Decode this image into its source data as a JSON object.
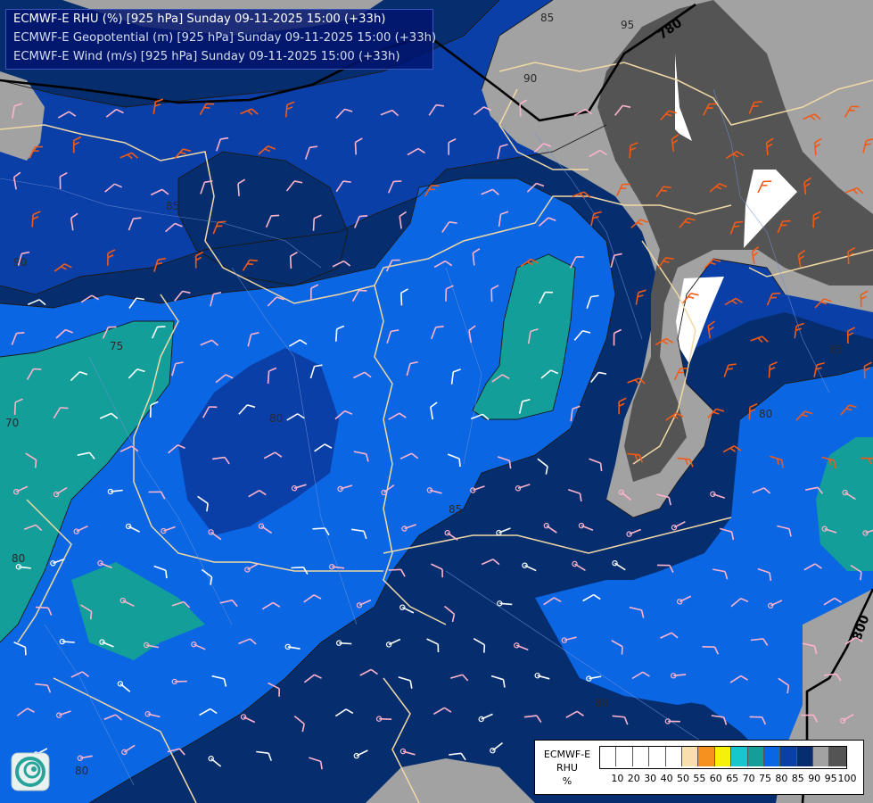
{
  "titles": {
    "line1": "ECMWF-E RHU (%) [925 hPa] Sunday 09-11-2025 15:00 (+33h)",
    "line2": "ECMWF-E Geopotential (m) [925 hPa] Sunday 09-11-2025 15:00 (+33h)",
    "line3": "ECMWF-E Wind (m/s) [925 hPa] Sunday 09-11-2025 15:00 (+33h)"
  },
  "legend": {
    "label_line1": "ECMWF-E",
    "label_line2": "RHU",
    "label_line3": "%",
    "ticks": [
      "10",
      "20",
      "30",
      "40",
      "50",
      "55",
      "60",
      "65",
      "70",
      "75",
      "80",
      "85",
      "90",
      "95",
      "100"
    ],
    "colors": [
      "#ffffff",
      "#ffffff",
      "#ffffff",
      "#ffffff",
      "#ffffff",
      "#f9deae",
      "#f6901e",
      "#f5f10a",
      "#17c7cc",
      "#139e99",
      "#0b66e3",
      "#0a3fa8",
      "#062e6e",
      "#a2a2a2",
      "#545454"
    ]
  },
  "contour_labels": {
    "rhu": [
      "95",
      "90",
      "85",
      "85",
      "90",
      "75",
      "70",
      "80",
      "85",
      "85",
      "80",
      "80",
      "80",
      "80"
    ],
    "geopotential": [
      "780",
      "800"
    ]
  },
  "wind": {
    "orange_color": "#f45a14",
    "pink_color": "#ffb3cc",
    "white_color": "#ffffff"
  },
  "logo": {
    "name": "ecmwf-logo"
  }
}
